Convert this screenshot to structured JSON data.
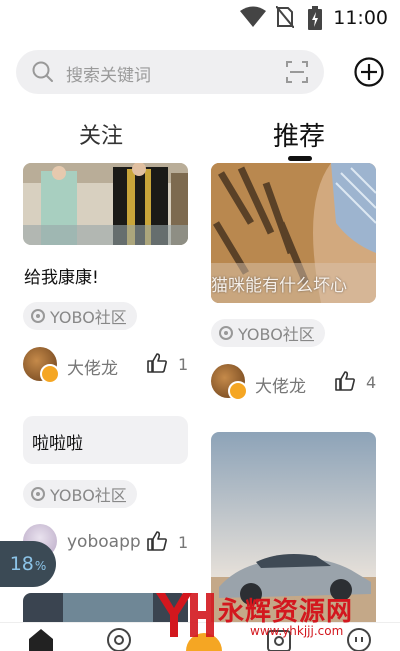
{
  "status_bar": {
    "time": "11:00",
    "icons": [
      "wifi-icon",
      "no-sim-icon",
      "battery-charging-icon"
    ]
  },
  "search": {
    "placeholder": "搜索关键词",
    "icons": [
      "search-icon",
      "scan-icon"
    ]
  },
  "header": {
    "add_icon": "plus-circle-icon"
  },
  "tabs": [
    {
      "label": "关注",
      "active": false
    },
    {
      "label": "推荐",
      "active": true
    }
  ],
  "feed": {
    "left_column": [
      {
        "type": "image",
        "image": "costume-stage-photo",
        "title": "给我康康!",
        "tag": "YOBO社区",
        "author": "大佬龙",
        "verified": true,
        "likes": "1"
      },
      {
        "type": "text",
        "text": "啦啦啦",
        "tag": "YOBO社区",
        "author": "yoboapp",
        "verified": false,
        "likes": "1"
      }
    ],
    "right_column": [
      {
        "type": "image",
        "image": "tiger-cub-photo",
        "caption": "猫咪能有什么坏心",
        "tag": "YOBO社区",
        "author": "大佬龙",
        "verified": true,
        "likes": "4"
      },
      {
        "type": "image",
        "image": "car-desert-photo"
      }
    ]
  },
  "progress_badge": {
    "value": "18",
    "unit": "%"
  },
  "bottom_nav": [
    "home-icon",
    "discover-icon",
    "publish-icon",
    "camera-icon",
    "profile-icon"
  ],
  "watermark": {
    "text": "永辉资源网",
    "url": "www.yhkjjj.com"
  },
  "colors": {
    "accent_orange": "#f5a623",
    "watermark_red": "#d3171e",
    "badge_bg": "#3b4a55"
  }
}
